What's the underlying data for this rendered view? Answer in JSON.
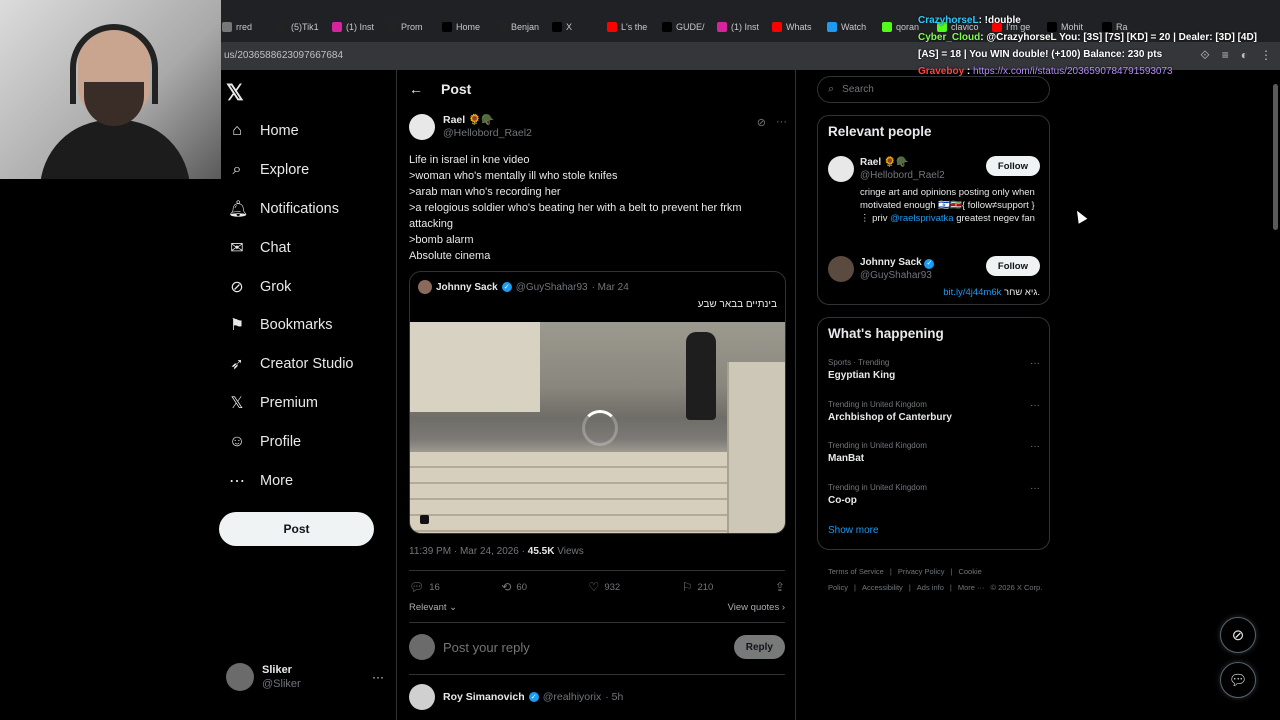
{
  "browser": {
    "tabs": [
      {
        "label": "rred",
        "color": "#777"
      },
      {
        "label": "(5)Tik1",
        "color": "#222"
      },
      {
        "label": "(1) Inst",
        "color": "#d6249f"
      },
      {
        "label": "Prom",
        "color": "#222"
      },
      {
        "label": "Home",
        "color": "#000"
      },
      {
        "label": "Benjan",
        "color": "#222"
      },
      {
        "label": "X",
        "color": "#000"
      },
      {
        "label": "L's the",
        "color": "#ff0000"
      },
      {
        "label": "GUDE/",
        "color": "#000"
      },
      {
        "label": "(1) Inst",
        "color": "#d6249f"
      },
      {
        "label": "Whats",
        "color": "#ff0000"
      },
      {
        "label": "Watch",
        "color": "#1d9bf0"
      },
      {
        "label": "qoran",
        "color": "#53fc18"
      },
      {
        "label": "clavico",
        "color": "#53fc18"
      },
      {
        "label": "I'm ge",
        "color": "#ff0000"
      },
      {
        "label": "Mohit",
        "color": "#000"
      },
      {
        "label": "Ra",
        "color": "#000"
      }
    ],
    "url": "us/2036588623097667684",
    "new_tab_label": "+"
  },
  "chat_overlay": {
    "line1_user": "CrazyhorseL",
    "line1_msg": ": !double",
    "line2_user": "Cyber_Cloud",
    "line2_msg": ": @CrazyhorseL You: [3S] [7S] [KD] = 20 | Dealer: [3D] [4D] [AS] = 18 | You WIN double! (+100) Balance: 230 pts",
    "line3_user": "Graveboy",
    "line3_link": "https://x.com/i/status/2036590784791593073"
  },
  "nav": {
    "logo": "𝕏",
    "items": [
      {
        "label": "Home",
        "icon": "⌂",
        "name": "home"
      },
      {
        "label": "Explore",
        "icon": "⌕",
        "name": "explore"
      },
      {
        "label": "Notifications",
        "icon": "🔔︎",
        "name": "notifications"
      },
      {
        "label": "Chat",
        "icon": "✉",
        "name": "chat"
      },
      {
        "label": "Grok",
        "icon": "⊘",
        "name": "grok"
      },
      {
        "label": "Bookmarks",
        "icon": "⚑",
        "name": "bookmarks"
      },
      {
        "label": "Creator Studio",
        "icon": "➶",
        "name": "creator-studio"
      },
      {
        "label": "Premium",
        "icon": "𝕏",
        "name": "premium"
      },
      {
        "label": "Profile",
        "icon": "☺",
        "name": "profile"
      },
      {
        "label": "More",
        "icon": "⋯",
        "name": "more"
      }
    ],
    "post_button": "Post",
    "account": {
      "name": "Sliker",
      "handle": "@Sliker",
      "more": "···"
    }
  },
  "post": {
    "header_title": "Post",
    "author_name": "Rael 🌻🪖",
    "author_handle": "@Hellobord_Rael2",
    "more": "···",
    "text_lines": [
      "Life in israel in kne video",
      ">woman who's mentally ill who stole knifes",
      ">arab man who's recording her",
      ">a relogious soldier who's beating her with a belt to prevent her frkm attacking",
      ">bomb alarm",
      "Absolute cinema"
    ],
    "quote": {
      "name": "Johnny Sack",
      "handle": "@GuyShahar93",
      "date": "· Mar 24",
      "text": "בינתיים בבאר שבע"
    },
    "timestamp": "11:39 PM · Mar 24, 2026 ·",
    "views_count": "45.5K",
    "views_label": "Views",
    "stats": {
      "replies": "16",
      "reposts": "60",
      "likes": "932",
      "bookmarks": "210"
    },
    "sort_label": "Relevant ⌄",
    "view_quotes": "View quotes ›",
    "reply_placeholder": "Post your reply",
    "reply_button": "Reply",
    "first_reply": {
      "name": "Roy Simanovich",
      "handle": "@realhiyorix",
      "time": "· 5h"
    }
  },
  "right": {
    "search_placeholder": "Search",
    "relevant_title": "Relevant people",
    "people": [
      {
        "name": "Rael 🌻🪖",
        "handle": "@Hellobord_Rael2",
        "bio": "cringe art and opinions posting only when motivated enough 🇮🇱🇸🇷{ follow≠support } ⋮ priv ",
        "bio_mention": "@raelsprivatka",
        "bio_tail": " greatest negev fan",
        "follow": "Follow"
      },
      {
        "name": "Johnny Sack",
        "handle": "@GuyShahar93",
        "bio_link": "bit.ly/4j44m6k",
        "bio_tail": " גיא שחר.",
        "follow": "Follow"
      }
    ],
    "happening_title": "What's happening",
    "trends": [
      {
        "context": "Sports · Trending",
        "name": "Egyptian King"
      },
      {
        "context": "Trending in United Kingdom",
        "name": "Archbishop of Canterbury"
      },
      {
        "context": "Trending in United Kingdom",
        "name": "ManBat"
      },
      {
        "context": "Trending in United Kingdom",
        "name": "Co-op"
      }
    ],
    "show_more": "Show more",
    "footer": [
      "Terms of Service",
      "|",
      "Privacy Policy",
      "|",
      "Cookie Policy",
      "|",
      "Accessibility",
      "|",
      "Ads info",
      "|",
      "More ···",
      "© 2026 X Corp."
    ]
  }
}
